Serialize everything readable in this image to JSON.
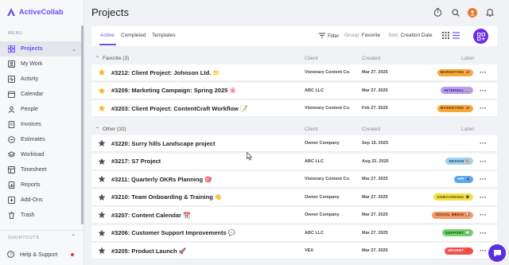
{
  "app": {
    "name": "ActiveCollab",
    "brand_color": "#6c4cf5"
  },
  "sidebar": {
    "menu_label": "MENU",
    "items": [
      {
        "label": "Projects",
        "icon": "grid-icon",
        "active": true
      },
      {
        "label": "My Work",
        "icon": "person-box-icon"
      },
      {
        "label": "Activity",
        "icon": "pulse-icon"
      },
      {
        "label": "Calendar",
        "icon": "calendar-icon"
      },
      {
        "label": "People",
        "icon": "people-icon"
      },
      {
        "label": "Invoices",
        "icon": "invoice-icon"
      },
      {
        "label": "Estimates",
        "icon": "estimate-icon"
      },
      {
        "label": "Workload",
        "icon": "stack-icon"
      },
      {
        "label": "Timesheet",
        "icon": "timesheet-icon"
      },
      {
        "label": "Reports",
        "icon": "reports-icon"
      },
      {
        "label": "Add-Ons",
        "icon": "addons-icon"
      },
      {
        "label": "Trash",
        "icon": "trash-icon"
      }
    ],
    "shortcuts_label": "SHORTCUTS",
    "help_label": "Help & Support"
  },
  "header": {
    "title": "Projects"
  },
  "tabs": [
    {
      "label": "Active",
      "active": true
    },
    {
      "label": "Completed"
    },
    {
      "label": "Templates"
    }
  ],
  "toolbar": {
    "filter_label": "Filter",
    "group_prefix": "Group:",
    "group_value": "Favorite",
    "sort_prefix": "Sort:",
    "sort_value": "Creation Date"
  },
  "columns": {
    "client": "Client",
    "created": "Created",
    "label": "Label"
  },
  "sections": [
    {
      "title": "Favorite (3)",
      "rows": [
        {
          "name": "#3212: Client Project: Johnson Ltd. 📁",
          "client": "Visionary Content Co.",
          "created": "Mar 27. 2025",
          "label": "MARKETING 📣",
          "label_bg": "#f6a83a",
          "label_fg": "#5a3200",
          "starred": true
        },
        {
          "name": "#3209: Marketing Campaign: Spring 2025 🌸",
          "client": "ABC LLC",
          "created": "Mar 27. 2025",
          "label": "INTERNAL 🔒",
          "label_bg": "#b79cf0",
          "label_fg": "#3b1f7a",
          "starred": true
        },
        {
          "name": "#3203: Client Project: ContentCraft Workflow 📝",
          "client": "Visionary Content Co.",
          "created": "Feb 27. 2025",
          "label": "MARKETING 📣",
          "label_bg": "#f6a83a",
          "label_fg": "#5a3200",
          "starred": true
        }
      ]
    },
    {
      "title": "Other (32)",
      "rows": [
        {
          "name": "#3220: Surry hills Landscape project",
          "client": "Owner Company",
          "created": "Sep 15. 2025",
          "label": "",
          "starred": false
        },
        {
          "name": "#3217: S7 Project",
          "client": "ABC LLC",
          "created": "Aug 22. 2025",
          "label": "DESIGN 🎨",
          "label_bg": "#9fd4f0",
          "label_fg": "#0b4a66",
          "starred": false
        },
        {
          "name": "#3211: Quarterly OKRs Planning 🎯",
          "client": "Visionary Content Co.",
          "created": "Mar 27. 2025",
          "label": "API 🔌",
          "label_bg": "#5aa8f2",
          "label_fg": "#ffffff",
          "starred": false
        },
        {
          "name": "#3210: Team Onboarding & Training 👋",
          "client": "Owner Company",
          "created": "Mar 27. 2025",
          "label": "ONBOARDING 🎓",
          "label_bg": "#f2e24a",
          "label_fg": "#4f4500",
          "starred": false
        },
        {
          "name": "#3207: Content Calendar 📆",
          "client": "Owner Company",
          "created": "Mar 27. 2025",
          "label": "SOCIAL MEDIA 📢",
          "label_bg": "#f39a6b",
          "label_fg": "#5a2100",
          "starred": false
        },
        {
          "name": "#3206: Customer Support Improvements 💬",
          "client": "ABC LLC",
          "created": "Mar 27. 2025",
          "label": "SUPPORT 💬",
          "label_bg": "#6fd36a",
          "label_fg": "#12450f",
          "starred": false
        },
        {
          "name": "#3205: Product Launch 🚀",
          "client": "VEX",
          "created": "Mar 27. 2025",
          "label": "URGENT 🔴",
          "label_bg": "#f0504a",
          "label_fg": "#ffffff",
          "starred": false
        }
      ]
    }
  ]
}
